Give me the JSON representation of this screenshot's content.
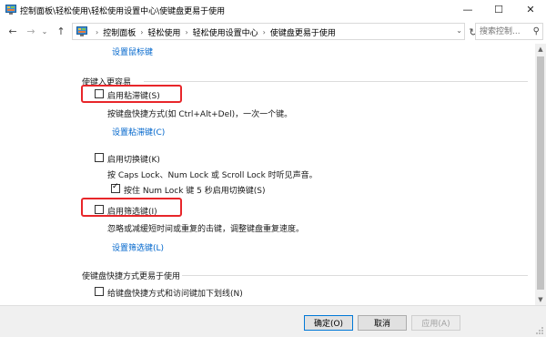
{
  "window": {
    "title": "控制面板\\轻松使用\\轻松使用设置中心\\使键盘更易于使用",
    "min_icon": "—",
    "max_icon": "☐",
    "close_icon": "✕"
  },
  "nav": {
    "back_icon": "←",
    "forward_icon": "→",
    "recent_icon": "⌄",
    "up_icon": "↑",
    "breadcrumbs": [
      "控制面板",
      "轻松使用",
      "轻松使用设置中心",
      "使键盘更易于使用"
    ],
    "crumb_sep_icon": "›",
    "dropdown_icon": "⌄",
    "refresh_icon": "↻",
    "search_placeholder": "搜索控制...",
    "search_icon": "⚲"
  },
  "content": {
    "mouse_keys_link": "设置鼠标键",
    "section_easier_typing": "使键入更容易",
    "sticky_keys": {
      "label": "启用粘滞键(S)",
      "checked": false,
      "description": "按键盘快捷方式(如 Ctrl+Alt+Del)，一次一个键。",
      "settings_link": "设置粘滞键(C)"
    },
    "toggle_keys": {
      "label": "启用切换键(K)",
      "checked": false,
      "description": "按 Caps Lock、Num Lock 或 Scroll Lock 时听见声音。",
      "sub_label": "按住 Num Lock 键 5 秒启用切换键(S)",
      "sub_checked": true
    },
    "filter_keys": {
      "label": "启用筛选键(I)",
      "checked": false,
      "description": "忽略或减缓短时间或重复的击键，调整键盘重复速度。",
      "settings_link": "设置筛选键(L)"
    },
    "section_shortcuts": "使键盘快捷方式更易于使用",
    "underline_shortcuts": {
      "label": "给键盘快捷方式和访问键加下划线(N)",
      "checked": false
    }
  },
  "scrollbar": {
    "up_icon": "▲",
    "down_icon": "▼"
  },
  "buttons": {
    "ok": "确定(O)",
    "cancel": "取消",
    "apply": "应用(A)"
  },
  "colors": {
    "link": "#0066cc",
    "highlight": "#e8262a",
    "ok_border": "#0078d7"
  }
}
